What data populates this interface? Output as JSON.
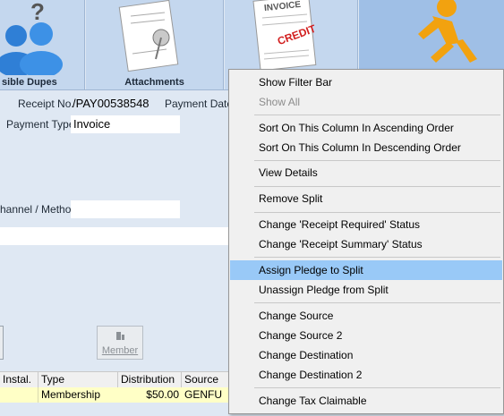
{
  "toolbar": {
    "dupes_label": "sible Dupes",
    "attachments_label": "Attachments",
    "invoice_label": "INVOICE",
    "credit_label": "CREDIT"
  },
  "form": {
    "receipt_no_label": "Receipt No.",
    "receipt_no_value": "/PAY00538548",
    "payment_date_label": "Payment Date",
    "payment_type_label": "Payment Type",
    "payment_type_value": "Invoice",
    "channel_label": "hannel / Method",
    "channel_value": ""
  },
  "buttons": {
    "member_label": "Member"
  },
  "grid": {
    "headers": [
      "Instal.",
      "Type",
      "Distribution",
      "Source"
    ],
    "row": {
      "instal": "",
      "type": "Membership",
      "distribution": "$50.00",
      "source": "GENFU"
    }
  },
  "context_menu": {
    "items": [
      {
        "label": "Show Filter Bar",
        "enabled": true
      },
      {
        "label": "Show All",
        "enabled": false
      },
      {
        "label": "Sort On This Column In Ascending Order",
        "enabled": true
      },
      {
        "label": "Sort On This Column In Descending Order",
        "enabled": true
      },
      {
        "label": "View Details",
        "enabled": true
      },
      {
        "label": "Remove Split",
        "enabled": true
      },
      {
        "label": "Change 'Receipt Required' Status",
        "enabled": true
      },
      {
        "label": "Change 'Receipt Summary' Status",
        "enabled": true
      },
      {
        "label": "Assign Pledge to Split",
        "enabled": true,
        "highlighted": true
      },
      {
        "label": "Unassign Pledge from Split",
        "enabled": true
      },
      {
        "label": "Change Source",
        "enabled": true
      },
      {
        "label": "Change Source 2",
        "enabled": true
      },
      {
        "label": "Change Destination",
        "enabled": true
      },
      {
        "label": "Change Destination 2",
        "enabled": true
      },
      {
        "label": "Change Tax Claimable",
        "enabled": true
      }
    ]
  },
  "colors": {
    "background": "#dfe8f3",
    "tile": "#c4d7ee",
    "highlight": "#99c9f7",
    "grid_row": "#ffffc6"
  }
}
